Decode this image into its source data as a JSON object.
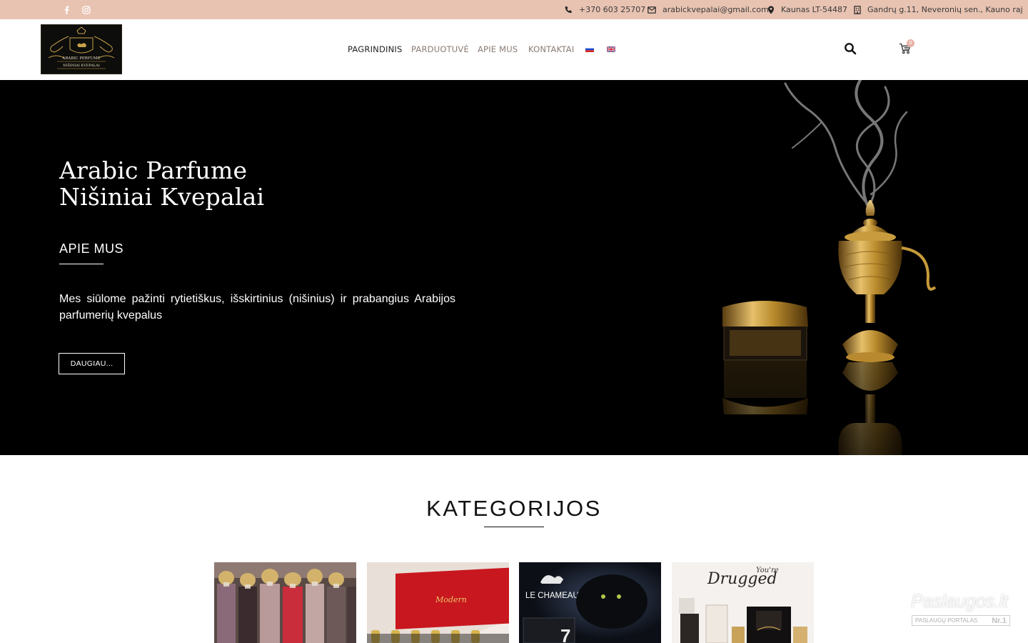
{
  "topbar": {
    "social": [
      "facebook-icon",
      "instagram-icon"
    ],
    "phone": "+370 603 25707",
    "email": "arabickvepalai@gmail.com",
    "city": "Kaunas LT-54487",
    "address": "Gandrų g.11, Neveronių sen., Kauno raj",
    "bg_color": "#e8c3b2"
  },
  "header": {
    "logo_text_top": "ARABIC PERFUME",
    "logo_text_bottom": "NIŠINIAI KVEPALAI",
    "nav": {
      "home": "PAGRINDINIS",
      "shop": "PARDUOTUVĖ",
      "about": "APIE MUS",
      "contacts": "KONTAKTAI"
    },
    "languages": [
      "ru",
      "en"
    ],
    "cart_count": "0"
  },
  "hero": {
    "title_line1": "Arabic Parfume",
    "title_line2": "Nišiniai Kvepalai",
    "subtitle": "APIE MUS",
    "text": "Mes siūlome pažinti rytietiškus, išskirtinius (nišinius) ir prabangius Arabijos parfumerių kvepalus",
    "button": "DAUGIAU..."
  },
  "categories": {
    "title": "KATEGORIJOS",
    "cards": [
      {
        "label": ""
      },
      {
        "label": "Modern"
      },
      {
        "label": "LE CHAMEAU"
      },
      {
        "label": "Drugged",
        "sub": "You're"
      }
    ]
  },
  "watermark": {
    "title": "Paslaugos.lt",
    "sub": "PASLAUGŲ PORTALAS",
    "badge": "Nr.1"
  }
}
